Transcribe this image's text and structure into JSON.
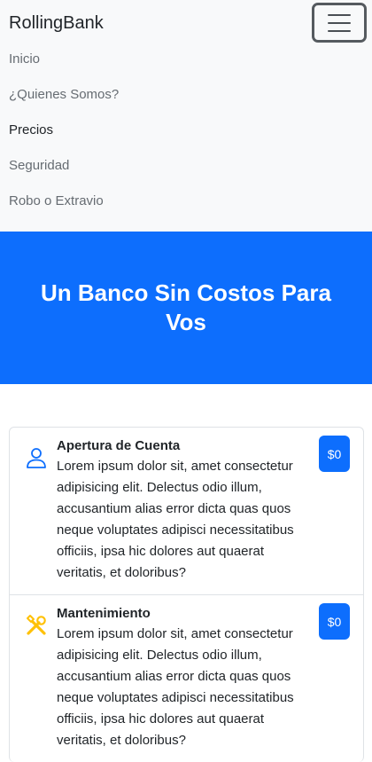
{
  "navbar": {
    "brand": "RollingBank",
    "toggler_icon": "hamburger-icon",
    "links": [
      {
        "label": "Inicio",
        "active": false
      },
      {
        "label": "¿Quienes Somos?",
        "active": false
      },
      {
        "label": "Precios",
        "active": true
      },
      {
        "label": "Seguridad",
        "active": false
      },
      {
        "label": "Robo o Extravio",
        "active": false
      }
    ]
  },
  "hero": {
    "title": "Un Banco Sin Costos Para Vos"
  },
  "colors": {
    "primary": "#0d6efd",
    "warning": "#ffc107",
    "navbar_bg": "#f8f9fa"
  },
  "plans": [
    {
      "icon": "person-icon",
      "title": "Apertura de Cuenta",
      "description": "Lorem ipsum dolor sit, amet consectetur adipisicing elit. Delectus odio illum, accusantium alias error dicta quas quos neque voluptates adipisci necessitatibus officiis, ipsa hic dolores aut quaerat veritatis, et doloribus?",
      "price": "$0"
    },
    {
      "icon": "tools-icon",
      "title": "Mantenimiento",
      "description": "Lorem ipsum dolor sit, amet consectetur adipisicing elit. Delectus odio illum, accusantium alias error dicta quas quos neque voluptates adipisci necessitatibus officiis, ipsa hic dolores aut quaerat veritatis, et doloribus?",
      "price": "$0"
    }
  ]
}
